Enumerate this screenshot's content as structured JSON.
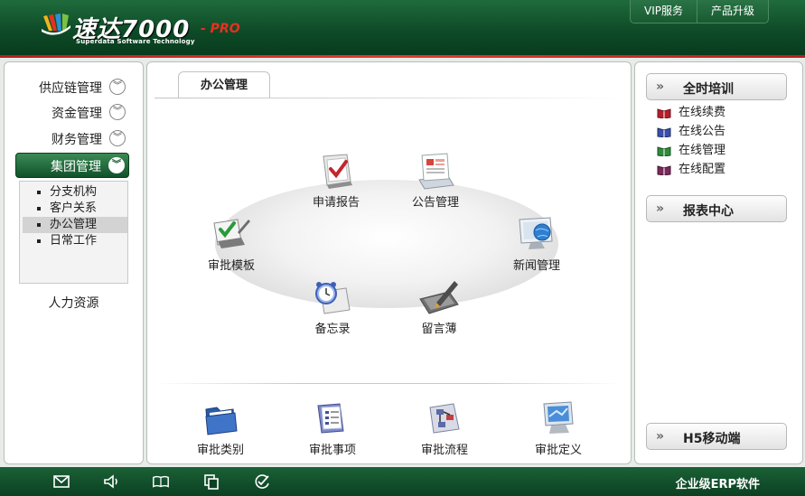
{
  "header": {
    "logo_text": "速达7000",
    "logo_pro": "- PRO",
    "logo_subtitle": "Superdata Software Technology",
    "links": [
      "VIP服务",
      "产品升级"
    ]
  },
  "sidebar": {
    "items": [
      {
        "label": "供应链管理"
      },
      {
        "label": "资金管理"
      },
      {
        "label": "财务管理"
      },
      {
        "label": "集团管理",
        "active": true
      }
    ],
    "submenu": [
      "分支机构",
      "客户关系",
      "办公管理",
      "日常工作"
    ],
    "selected_sub": "办公管理",
    "bottom_item": "人力资源"
  },
  "main": {
    "tab_label": "办公管理",
    "ring_apps": [
      "申请报告",
      "公告管理",
      "审批模板",
      "新闻管理",
      "备忘录",
      "留言薄"
    ],
    "bottom_apps": [
      "审批类别",
      "审批事项",
      "审批流程",
      "审批定义"
    ]
  },
  "right": {
    "training": "全时培训",
    "training_links": [
      "在线续费",
      "在线公告",
      "在线管理",
      "在线配置"
    ],
    "report": "报表中心",
    "mobile": "H5移动端",
    "arrow": "»"
  },
  "footer": {
    "text": "企业级ERP软件",
    "icons": [
      "mail-icon",
      "speaker-icon",
      "book-icon",
      "copy-icon",
      "check-circle-icon"
    ]
  },
  "colors": {
    "header_green": "#0e4a27",
    "accent_red": "#e43a2c",
    "active_green": "#10522a"
  }
}
